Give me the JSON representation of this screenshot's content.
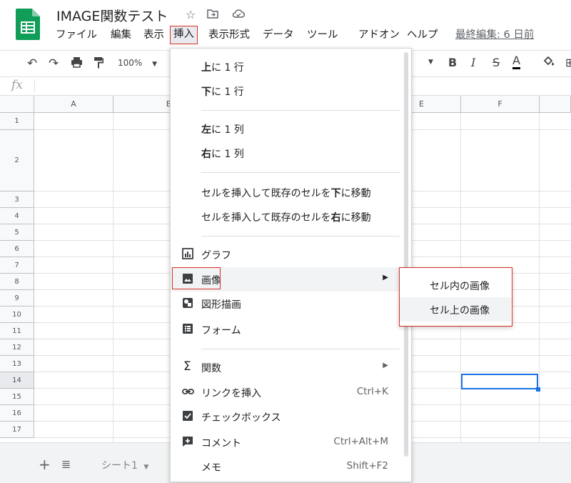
{
  "header": {
    "title": "IMAGE関数テスト",
    "menu": [
      "ファイル",
      "編集",
      "表示",
      "挿入",
      "表示形式",
      "データ",
      "ツール",
      "アドオン",
      "ヘルプ"
    ],
    "last_edit": "最終編集: 6 日前"
  },
  "toolbar": {
    "zoom": "100%"
  },
  "grid": {
    "columns": [
      "A",
      "B",
      "E",
      "F"
    ],
    "rows": [
      "1",
      "2",
      "3",
      "4",
      "5",
      "6",
      "7",
      "8",
      "9",
      "10",
      "11",
      "12",
      "13",
      "14",
      "15",
      "16",
      "17"
    ]
  },
  "sheets": {
    "tab": "シート1"
  },
  "insert_menu": {
    "row_above": {
      "bold": "上",
      "rest": "に 1 行"
    },
    "row_below": {
      "bold": "下",
      "rest": "に 1 行"
    },
    "col_left": {
      "bold": "左",
      "rest": "に 1 列"
    },
    "col_right": {
      "bold": "右",
      "rest": "に 1 列"
    },
    "cells_shift_down": {
      "pre": "セルを挿入して既存のセルを",
      "bold": "下",
      "post": "に移動"
    },
    "cells_shift_right": {
      "pre": "セルを挿入して既存のセルを",
      "bold": "右",
      "post": "に移動"
    },
    "chart": "グラフ",
    "image": "画像",
    "drawing": "図形描画",
    "form": "フォーム",
    "function": "関数",
    "link": {
      "label": "リンクを挿入",
      "shortcut": "Ctrl+K"
    },
    "checkbox": "チェックボックス",
    "comment": {
      "label": "コメント",
      "shortcut": "Ctrl+Alt+M"
    },
    "note": {
      "label": "メモ",
      "shortcut": "Shift+F2"
    }
  },
  "image_submenu": {
    "in_cell": "セル内の画像",
    "over_cells": "セル上の画像"
  },
  "colors": {
    "accent_red": "#d93025",
    "selection_blue": "#1a73e8",
    "sheets_green": "#0f9d58"
  }
}
